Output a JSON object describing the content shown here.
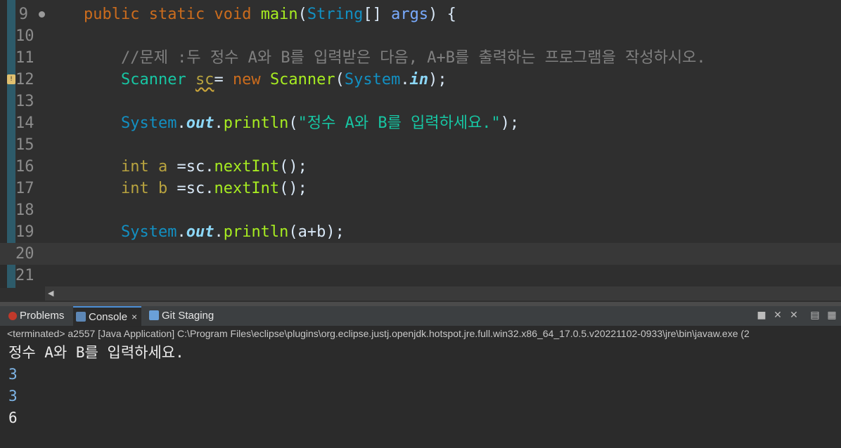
{
  "editor": {
    "lines": [
      {
        "n": "9",
        "tokens": [
          [
            "    ",
            ""
          ],
          [
            "public",
            "kw"
          ],
          [
            " ",
            ""
          ],
          [
            "static",
            "kw"
          ],
          [
            " ",
            ""
          ],
          [
            "void",
            "kw"
          ],
          [
            " ",
            ""
          ],
          [
            "main",
            "fn"
          ],
          [
            "(",
            ""
          ],
          [
            "String",
            "ty"
          ],
          [
            "[] ",
            ""
          ],
          [
            "args",
            "var"
          ],
          [
            ") {",
            ""
          ]
        ]
      },
      {
        "n": "10",
        "tokens": []
      },
      {
        "n": "11",
        "tokens": [
          [
            "        ",
            ""
          ],
          [
            "//문제 :두 정수 A와 B를 입력받은 다음, A+B를 출력하는 프로그램을 작성하시오.",
            "cm"
          ]
        ]
      },
      {
        "n": "12",
        "tokens": [
          [
            "        ",
            ""
          ],
          [
            "Scanner",
            "ty2"
          ],
          [
            " ",
            ""
          ],
          [
            "sc",
            "kw2 warn"
          ],
          [
            "= ",
            ""
          ],
          [
            "new",
            "kw"
          ],
          [
            " ",
            ""
          ],
          [
            "Scanner",
            "fn"
          ],
          [
            "(",
            ""
          ],
          [
            "System",
            "ty"
          ],
          [
            ".",
            ""
          ],
          [
            "in",
            "fld"
          ],
          [
            ");",
            ""
          ]
        ]
      },
      {
        "n": "13",
        "tokens": []
      },
      {
        "n": "14",
        "tokens": [
          [
            "        ",
            ""
          ],
          [
            "System",
            "ty"
          ],
          [
            ".",
            ""
          ],
          [
            "out",
            "fld"
          ],
          [
            ".",
            ""
          ],
          [
            "println",
            "fn"
          ],
          [
            "(",
            ""
          ],
          [
            "\"정수 A와 B를 입력하세요.\"",
            "str"
          ],
          [
            ");",
            ""
          ]
        ]
      },
      {
        "n": "15",
        "tokens": []
      },
      {
        "n": "16",
        "tokens": [
          [
            "        ",
            ""
          ],
          [
            "int",
            "kw2"
          ],
          [
            " ",
            ""
          ],
          [
            "a",
            "kw2"
          ],
          [
            " =sc.",
            ""
          ],
          [
            "nextInt",
            "fn"
          ],
          [
            "();",
            ""
          ]
        ]
      },
      {
        "n": "17",
        "tokens": [
          [
            "        ",
            ""
          ],
          [
            "int",
            "kw2"
          ],
          [
            " ",
            ""
          ],
          [
            "b",
            "kw2"
          ],
          [
            " =sc.",
            ""
          ],
          [
            "nextInt",
            "fn"
          ],
          [
            "();",
            ""
          ]
        ]
      },
      {
        "n": "18",
        "tokens": []
      },
      {
        "n": "19",
        "tokens": [
          [
            "        ",
            ""
          ],
          [
            "System",
            "ty"
          ],
          [
            ".",
            ""
          ],
          [
            "out",
            "fld"
          ],
          [
            ".",
            ""
          ],
          [
            "println",
            "fn"
          ],
          [
            "(a+b);",
            ""
          ]
        ]
      },
      {
        "n": "20",
        "tokens": []
      },
      {
        "n": "21",
        "tokens": []
      }
    ],
    "current_line": "20",
    "warning_line": "12",
    "fold_line": "9"
  },
  "views": {
    "tabs": [
      {
        "name": "tab-problems",
        "label": "Problems",
        "icon": "problems-icon",
        "active": false
      },
      {
        "name": "tab-console",
        "label": "Console",
        "icon": "console-icon",
        "active": true
      },
      {
        "name": "tab-git-staging",
        "label": "Git Staging",
        "icon": "git-staging-icon",
        "active": false
      }
    ],
    "close_glyph": "×"
  },
  "console": {
    "terminated_label": "<terminated> a2557 [Java Application] C:\\Program Files\\eclipse\\plugins\\org.eclipse.justj.openjdk.hotspot.jre.full.win32.x86_64_17.0.5.v20221102-0933\\jre\\bin\\javaw.exe  (2",
    "output": [
      {
        "text": "정수 A와 B를 입력하세요.",
        "kind": "stdout"
      },
      {
        "text": "3",
        "kind": "stdin"
      },
      {
        "text": "3",
        "kind": "stdin"
      },
      {
        "text": "6",
        "kind": "stdout"
      }
    ]
  },
  "colors": {
    "editor_bg": "#2f2f2f",
    "console_bg": "#2b2b2b",
    "keyword": "#cc6c1d",
    "string": "#17c6a3"
  }
}
